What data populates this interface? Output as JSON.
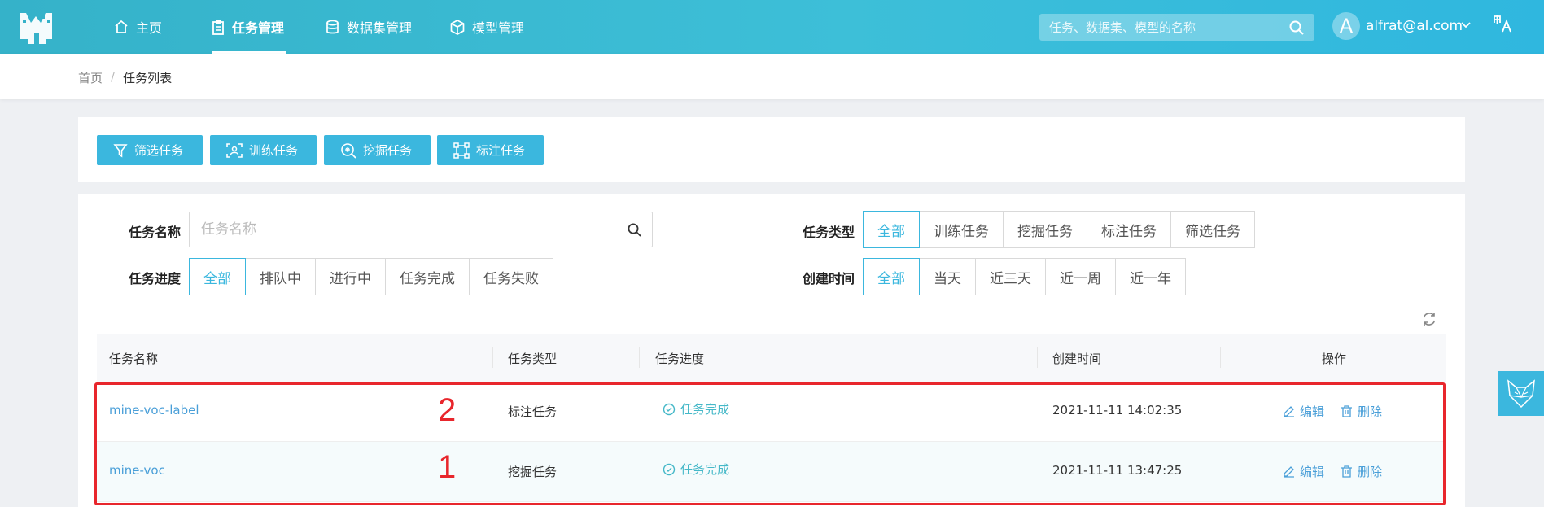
{
  "header": {
    "nav": [
      {
        "label": "主页",
        "icon": "home-icon"
      },
      {
        "label": "任务管理",
        "icon": "clipboard-icon"
      },
      {
        "label": "数据集管理",
        "icon": "database-icon"
      },
      {
        "label": "模型管理",
        "icon": "cube-icon"
      }
    ],
    "active_nav": "任务管理",
    "search_placeholder": "任务、数据集、模型的名称",
    "avatar_letter": "A",
    "user": "alfrat@al.com",
    "accent_color": "#3dbfd8"
  },
  "breadcrumb": {
    "home": "首页",
    "separator": "/",
    "current": "任务列表"
  },
  "actions": [
    {
      "label": "筛选任务",
      "icon": "filter-icon"
    },
    {
      "label": "训练任务",
      "icon": "train-icon"
    },
    {
      "label": "挖掘任务",
      "icon": "mine-icon"
    },
    {
      "label": "标注任务",
      "icon": "label-icon"
    }
  ],
  "filters": {
    "name_label": "任务名称",
    "name_placeholder": "任务名称",
    "progress_label": "任务进度",
    "progress_options": [
      "全部",
      "排队中",
      "进行中",
      "任务完成",
      "任务失败"
    ],
    "type_label": "任务类型",
    "type_options": [
      "全部",
      "训练任务",
      "挖掘任务",
      "标注任务",
      "筛选任务"
    ],
    "time_label": "创建时间",
    "time_options": [
      "全部",
      "当天",
      "近三天",
      "近一周",
      "近一年"
    ],
    "selected": "全部"
  },
  "table": {
    "columns": [
      "任务名称",
      "任务类型",
      "任务进度",
      "创建时间",
      "操作"
    ],
    "rows": [
      {
        "name": "mine-voc-label",
        "type": "标注任务",
        "status": "任务完成",
        "created": "2021-11-11 14:02:35",
        "edit": "编辑",
        "delete": "删除"
      },
      {
        "name": "mine-voc",
        "type": "挖掘任务",
        "status": "任务完成",
        "created": "2021-11-11 13:47:25",
        "edit": "编辑",
        "delete": "删除"
      }
    ]
  },
  "annotations": {
    "row1_number": "2",
    "row2_number": "1",
    "color": "#e8262c"
  }
}
